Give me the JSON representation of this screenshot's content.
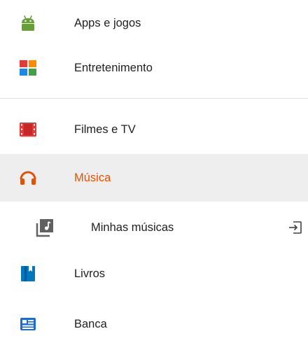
{
  "menu": {
    "items": [
      {
        "label": "Apps e jogos",
        "icon": "android-robot-icon",
        "color": "#689f38"
      },
      {
        "label": "Entretenimento",
        "icon": "entertainment-tiles-icon",
        "colors": [
          "#e53935",
          "#fb8c00",
          "#1e88e5",
          "#43a047"
        ]
      },
      {
        "label": "Filmes e TV",
        "icon": "film-strip-icon",
        "color": "#e53935"
      },
      {
        "label": "Música",
        "icon": "headphones-icon",
        "color": "#e65100",
        "selected": true
      },
      {
        "label": "Minhas músicas",
        "icon": "music-library-icon",
        "color": "#616161",
        "trailing_icon": "open-in-app-icon"
      },
      {
        "label": "Livros",
        "icon": "book-icon",
        "color": "#0277bd"
      },
      {
        "label": "Banca",
        "icon": "newsstand-icon",
        "color": "#1e6bd6"
      }
    ]
  },
  "colors": {
    "selected_text": "#e65100",
    "selected_background": "#eeeeee",
    "divider": "#e0e0e0",
    "text": "#212121"
  }
}
